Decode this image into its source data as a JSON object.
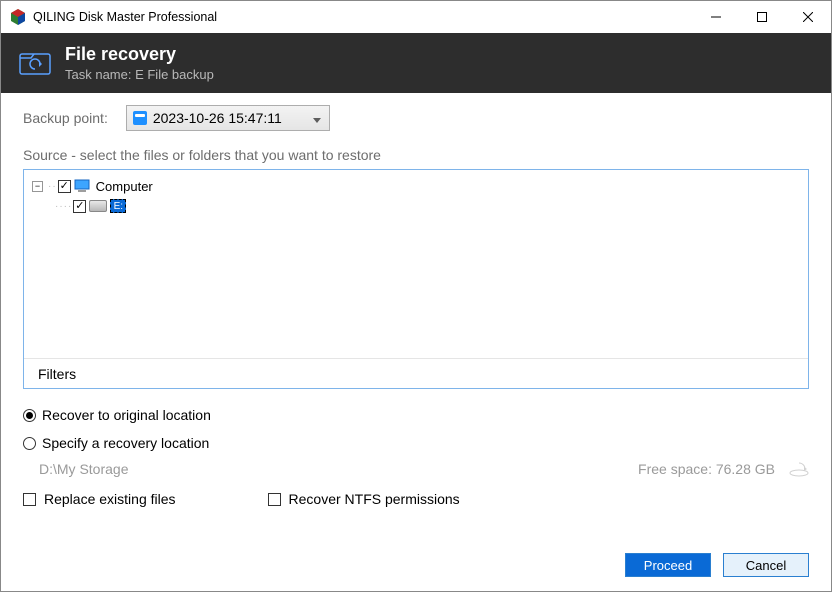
{
  "titlebar": {
    "title": "QILING Disk Master Professional"
  },
  "header": {
    "title": "File recovery",
    "task_line": "Task name: E  File backup"
  },
  "backup": {
    "label": "Backup point:",
    "selected": "2023-10-26 15:47:11"
  },
  "source_label": "Source - select the files or folders that you want to restore",
  "tree": {
    "root": "Computer",
    "drive_letter": "E:"
  },
  "filters_label": "Filters",
  "radios": {
    "original": "Recover to original location",
    "specify": "Specify a recovery location"
  },
  "path": {
    "value": "D:\\My Storage",
    "free": "Free space: 76.28 GB"
  },
  "checks": {
    "replace": "Replace existing files",
    "ntfs": "Recover NTFS permissions"
  },
  "buttons": {
    "proceed": "Proceed",
    "cancel": "Cancel"
  }
}
